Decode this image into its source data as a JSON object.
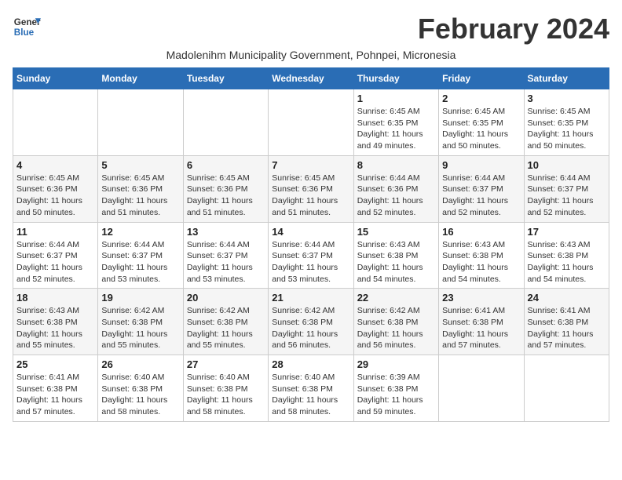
{
  "header": {
    "logo_line1": "General",
    "logo_line2": "Blue",
    "month_title": "February 2024",
    "subtitle": "Madolenihm Municipality Government, Pohnpei, Micronesia"
  },
  "weekdays": [
    "Sunday",
    "Monday",
    "Tuesday",
    "Wednesday",
    "Thursday",
    "Friday",
    "Saturday"
  ],
  "weeks": [
    [
      {
        "day": "",
        "info": ""
      },
      {
        "day": "",
        "info": ""
      },
      {
        "day": "",
        "info": ""
      },
      {
        "day": "",
        "info": ""
      },
      {
        "day": "1",
        "info": "Sunrise: 6:45 AM\nSunset: 6:35 PM\nDaylight: 11 hours\nand 49 minutes."
      },
      {
        "day": "2",
        "info": "Sunrise: 6:45 AM\nSunset: 6:35 PM\nDaylight: 11 hours\nand 50 minutes."
      },
      {
        "day": "3",
        "info": "Sunrise: 6:45 AM\nSunset: 6:35 PM\nDaylight: 11 hours\nand 50 minutes."
      }
    ],
    [
      {
        "day": "4",
        "info": "Sunrise: 6:45 AM\nSunset: 6:36 PM\nDaylight: 11 hours\nand 50 minutes."
      },
      {
        "day": "5",
        "info": "Sunrise: 6:45 AM\nSunset: 6:36 PM\nDaylight: 11 hours\nand 51 minutes."
      },
      {
        "day": "6",
        "info": "Sunrise: 6:45 AM\nSunset: 6:36 PM\nDaylight: 11 hours\nand 51 minutes."
      },
      {
        "day": "7",
        "info": "Sunrise: 6:45 AM\nSunset: 6:36 PM\nDaylight: 11 hours\nand 51 minutes."
      },
      {
        "day": "8",
        "info": "Sunrise: 6:44 AM\nSunset: 6:36 PM\nDaylight: 11 hours\nand 52 minutes."
      },
      {
        "day": "9",
        "info": "Sunrise: 6:44 AM\nSunset: 6:37 PM\nDaylight: 11 hours\nand 52 minutes."
      },
      {
        "day": "10",
        "info": "Sunrise: 6:44 AM\nSunset: 6:37 PM\nDaylight: 11 hours\nand 52 minutes."
      }
    ],
    [
      {
        "day": "11",
        "info": "Sunrise: 6:44 AM\nSunset: 6:37 PM\nDaylight: 11 hours\nand 52 minutes."
      },
      {
        "day": "12",
        "info": "Sunrise: 6:44 AM\nSunset: 6:37 PM\nDaylight: 11 hours\nand 53 minutes."
      },
      {
        "day": "13",
        "info": "Sunrise: 6:44 AM\nSunset: 6:37 PM\nDaylight: 11 hours\nand 53 minutes."
      },
      {
        "day": "14",
        "info": "Sunrise: 6:44 AM\nSunset: 6:37 PM\nDaylight: 11 hours\nand 53 minutes."
      },
      {
        "day": "15",
        "info": "Sunrise: 6:43 AM\nSunset: 6:38 PM\nDaylight: 11 hours\nand 54 minutes."
      },
      {
        "day": "16",
        "info": "Sunrise: 6:43 AM\nSunset: 6:38 PM\nDaylight: 11 hours\nand 54 minutes."
      },
      {
        "day": "17",
        "info": "Sunrise: 6:43 AM\nSunset: 6:38 PM\nDaylight: 11 hours\nand 54 minutes."
      }
    ],
    [
      {
        "day": "18",
        "info": "Sunrise: 6:43 AM\nSunset: 6:38 PM\nDaylight: 11 hours\nand 55 minutes."
      },
      {
        "day": "19",
        "info": "Sunrise: 6:42 AM\nSunset: 6:38 PM\nDaylight: 11 hours\nand 55 minutes."
      },
      {
        "day": "20",
        "info": "Sunrise: 6:42 AM\nSunset: 6:38 PM\nDaylight: 11 hours\nand 55 minutes."
      },
      {
        "day": "21",
        "info": "Sunrise: 6:42 AM\nSunset: 6:38 PM\nDaylight: 11 hours\nand 56 minutes."
      },
      {
        "day": "22",
        "info": "Sunrise: 6:42 AM\nSunset: 6:38 PM\nDaylight: 11 hours\nand 56 minutes."
      },
      {
        "day": "23",
        "info": "Sunrise: 6:41 AM\nSunset: 6:38 PM\nDaylight: 11 hours\nand 57 minutes."
      },
      {
        "day": "24",
        "info": "Sunrise: 6:41 AM\nSunset: 6:38 PM\nDaylight: 11 hours\nand 57 minutes."
      }
    ],
    [
      {
        "day": "25",
        "info": "Sunrise: 6:41 AM\nSunset: 6:38 PM\nDaylight: 11 hours\nand 57 minutes."
      },
      {
        "day": "26",
        "info": "Sunrise: 6:40 AM\nSunset: 6:38 PM\nDaylight: 11 hours\nand 58 minutes."
      },
      {
        "day": "27",
        "info": "Sunrise: 6:40 AM\nSunset: 6:38 PM\nDaylight: 11 hours\nand 58 minutes."
      },
      {
        "day": "28",
        "info": "Sunrise: 6:40 AM\nSunset: 6:38 PM\nDaylight: 11 hours\nand 58 minutes."
      },
      {
        "day": "29",
        "info": "Sunrise: 6:39 AM\nSunset: 6:38 PM\nDaylight: 11 hours\nand 59 minutes."
      },
      {
        "day": "",
        "info": ""
      },
      {
        "day": "",
        "info": ""
      }
    ]
  ]
}
